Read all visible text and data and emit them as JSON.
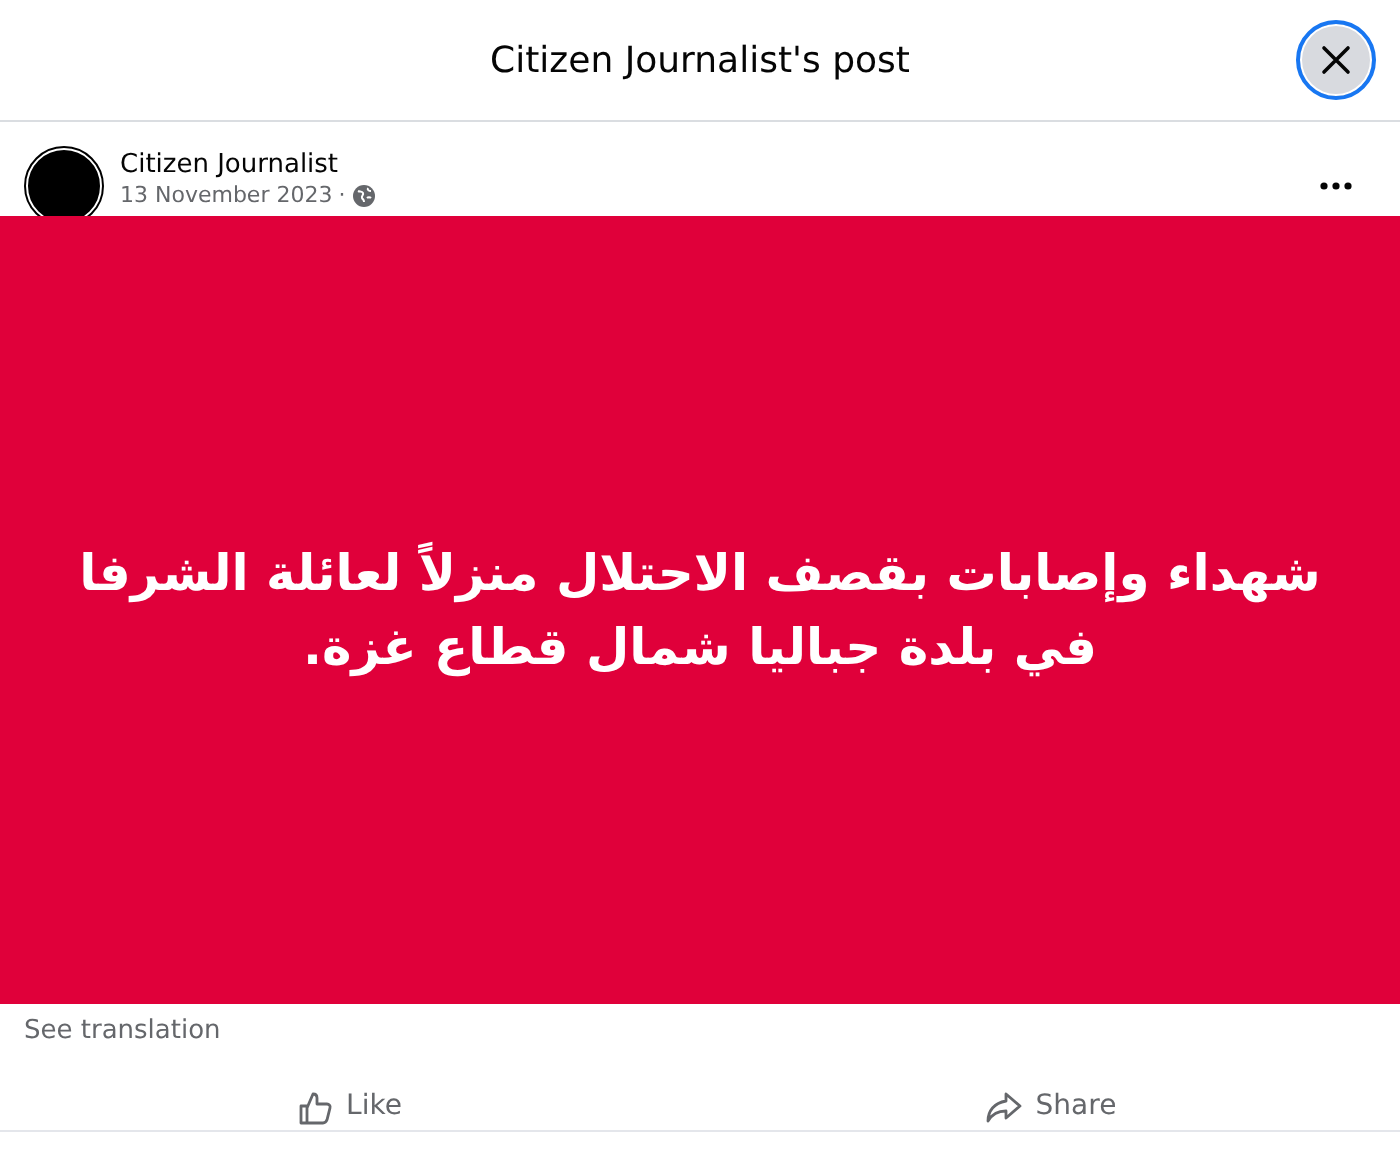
{
  "dialog": {
    "title": "Citizen Journalist's post"
  },
  "post": {
    "author": "Citizen Journalist",
    "date": "13 November 2023",
    "separator": "·",
    "text": "شهداء وإصابات بقصف الاحتلال منزلاً لعائلة الشرفا في بلدة جباليا شمال قطاع غزة.",
    "translation_link": "See translation"
  },
  "actions": [
    {
      "kind": "like",
      "label": "Like"
    },
    {
      "kind": "share",
      "label": "Share"
    }
  ]
}
